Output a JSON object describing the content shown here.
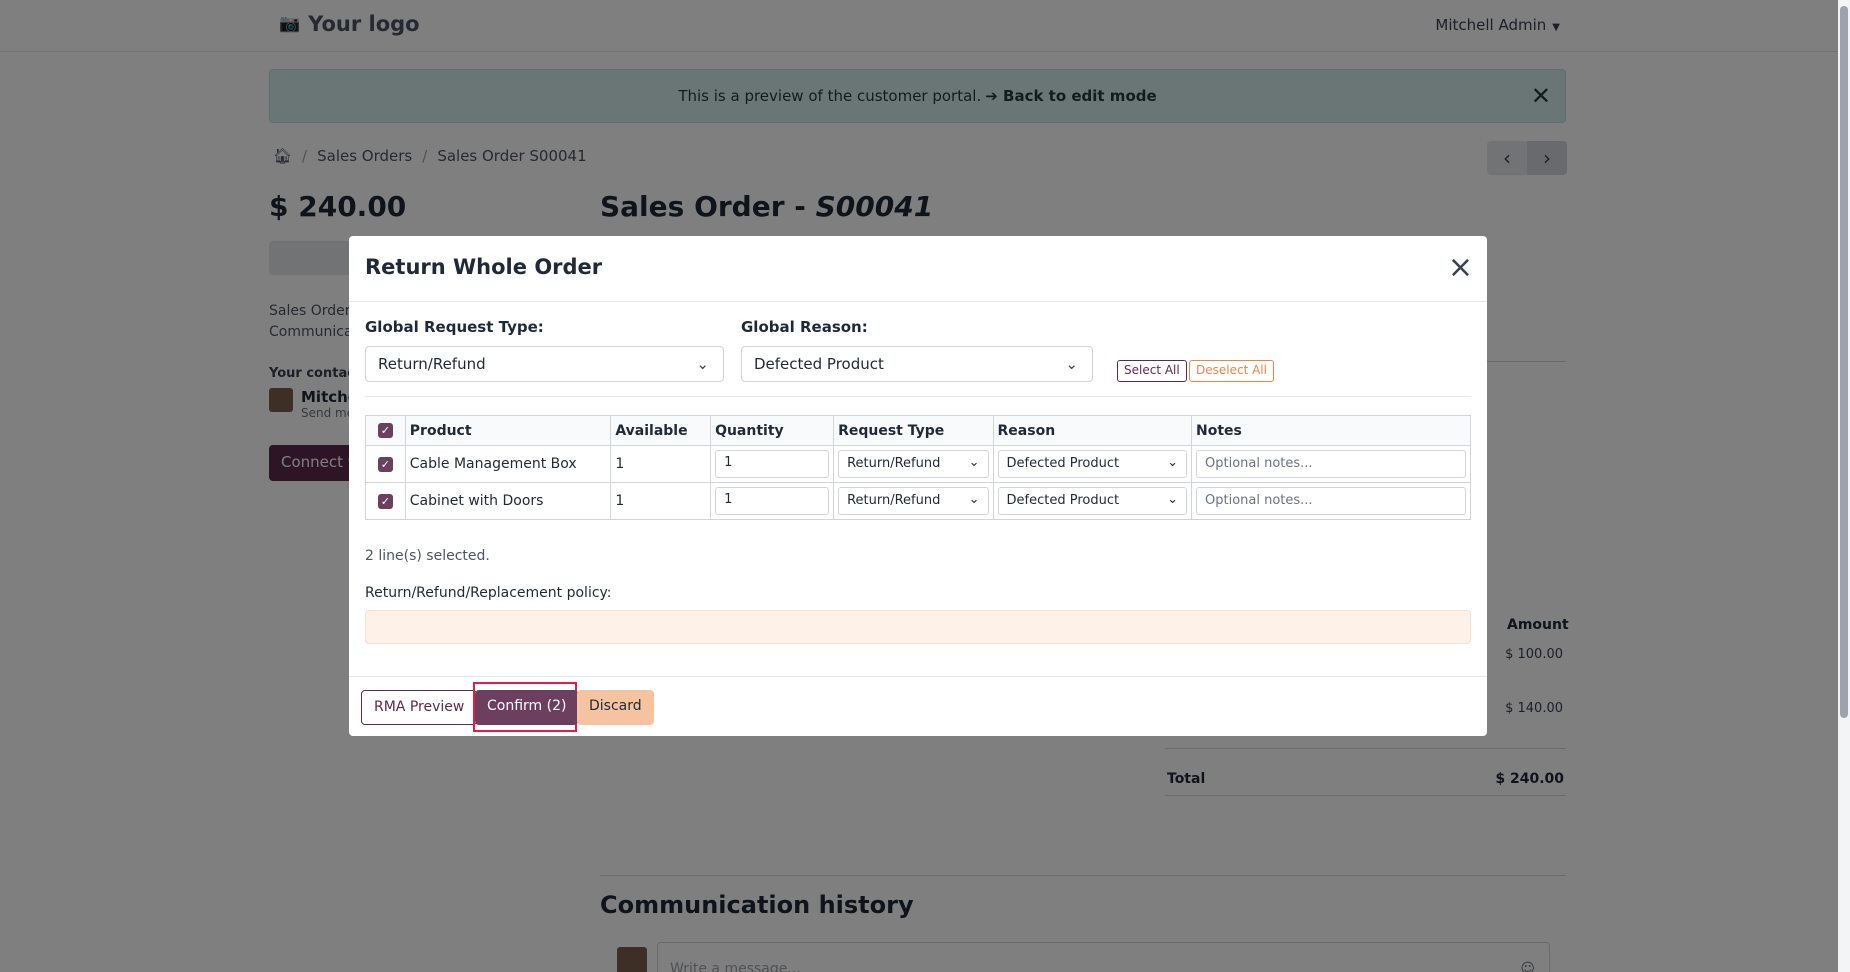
{
  "topbar": {
    "logo": "Your logo",
    "user": "Mitchell Admin"
  },
  "banner": {
    "text": "This is a preview of the customer portal.",
    "link": "➔ Back to edit mode"
  },
  "breadcrumb": {
    "orders": "Sales Orders",
    "current": "Sales Order S00041"
  },
  "sidebar": {
    "amount": "$ 240.00",
    "line1": "Sales Order -",
    "line2": "Communicat",
    "contact_label": "Your contact",
    "contact_name": "Mitchel",
    "contact_sub": "Send me",
    "connect": "Connect w"
  },
  "main": {
    "title_prefix": "Sales Order - ",
    "title_ref": "S00041",
    "amount_header": "Amount",
    "amounts": [
      "$ 100.00",
      "$ 140.00"
    ],
    "total_label": "Total",
    "total_value": "$ 240.00",
    "comm_title": "Communication history",
    "comm_placeholder": "Write a message..."
  },
  "modal": {
    "title": "Return Whole Order",
    "global_request_label": "Global Request Type:",
    "global_request_value": "Return/Refund",
    "global_reason_label": "Global Reason:",
    "global_reason_value": "Defected Product",
    "select_all": "Select All",
    "deselect_all": "Deselect All",
    "columns": [
      "Product",
      "Available",
      "Quantity",
      "Request Type",
      "Reason",
      "Notes"
    ],
    "rows": [
      {
        "product": "Cable Management Box",
        "available": "1",
        "quantity": "1",
        "request_type": "Return/Refund",
        "reason": "Defected Product",
        "notes_placeholder": "Optional notes..."
      },
      {
        "product": "Cabinet with Doors",
        "available": "1",
        "quantity": "1",
        "request_type": "Return/Refund",
        "reason": "Defected Product",
        "notes_placeholder": "Optional notes..."
      }
    ],
    "selected_count": "2 line(s) selected.",
    "policy_label": "Return/Refund/Replacement policy:",
    "rma_preview": "RMA Preview",
    "confirm": "Confirm (2)",
    "discard": "Discard"
  },
  "colors": {
    "brand": "#6d3f5e",
    "accent": "#e8864c",
    "banner": "#d4ecec"
  },
  "icons": [
    "camera-icon",
    "home-icon",
    "close-icon",
    "chevron-down-icon",
    "chevron-left-icon",
    "chevron-right-icon",
    "checkbox-checked-icon",
    "emoji-icon"
  ]
}
